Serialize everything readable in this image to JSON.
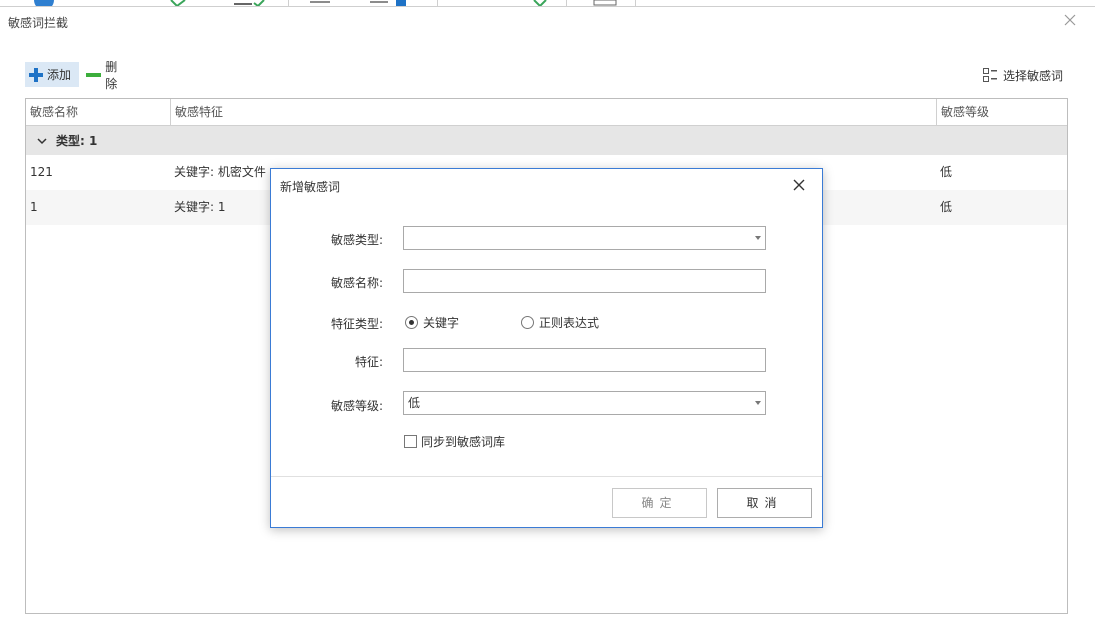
{
  "window": {
    "title": "敏感词拦截"
  },
  "toolbar": {
    "add_label": "添加",
    "delete_label": "删除",
    "select_label": "选择敏感词"
  },
  "table": {
    "columns": [
      "敏感名称",
      "敏感特征",
      "敏感等级"
    ],
    "group_label": "类型: 1",
    "rows": [
      {
        "name": "121",
        "feature": "关键字: 机密文件",
        "level": "低"
      },
      {
        "name": "1",
        "feature": "关键字: 1",
        "level": "低"
      }
    ]
  },
  "dialog": {
    "title": "新增敏感词",
    "fields": {
      "type_label": "敏感类型:",
      "type_value": "",
      "name_label": "敏感名称:",
      "name_value": "",
      "feature_type_label": "特征类型:",
      "radio_keyword": "关键字",
      "radio_regex": "正则表达式",
      "feature_label": "特征:",
      "feature_value": "",
      "level_label": "敏感等级:",
      "level_value": "低",
      "sync_label": "同步到敏感词库"
    },
    "selected_feature_type": "关键字",
    "sync_checked": false,
    "ok_label": "确定",
    "cancel_label": "取消"
  }
}
